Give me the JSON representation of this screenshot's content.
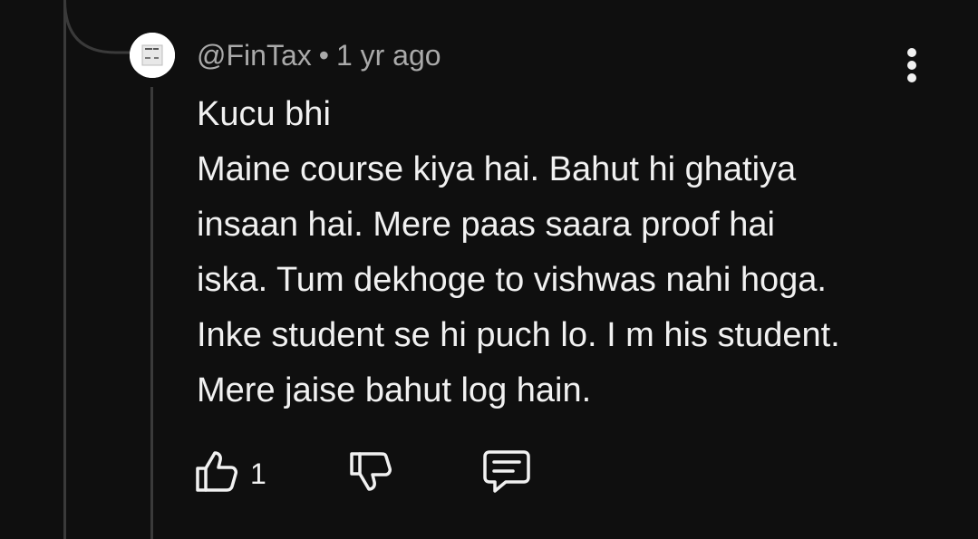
{
  "comment": {
    "handle": "@FinTax",
    "separator": "•",
    "time": "1 yr ago",
    "lines": [
      "Kucu bhi",
      "Maine course kiya hai. Bahut hi ghatiya",
      "insaan hai. Mere paas saara proof hai",
      "iska. Tum dekhoge to vishwas nahi hoga.",
      "Inke student se hi puch lo. I m his student.",
      "Mere jaise bahut log hain."
    ],
    "like_count": "1",
    "avatar_text": "FinTax"
  },
  "icons": {
    "like": "thumbs-up-icon",
    "dislike": "thumbs-down-icon",
    "reply": "reply-comment-icon",
    "menu": "more-vertical-icon"
  },
  "colors": {
    "background": "#0f0f0f",
    "text": "#f1f1f1",
    "meta": "#aaaaaa",
    "thread": "#3a3a3a"
  }
}
